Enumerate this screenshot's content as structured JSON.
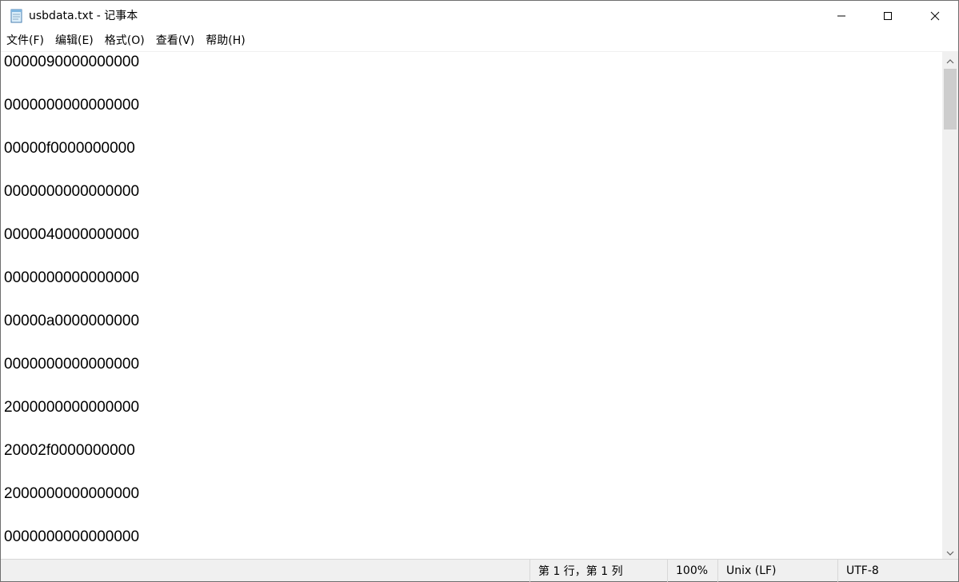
{
  "window": {
    "title": "usbdata.txt - 记事本"
  },
  "icons": {
    "app": "notepad-icon",
    "minimize": "minimize-icon",
    "maximize": "maximize-icon",
    "close": "close-icon",
    "scroll_up": "chevron-up-icon",
    "scroll_down": "chevron-down-icon"
  },
  "menu": {
    "file": "文件(F)",
    "edit": "编辑(E)",
    "format": "格式(O)",
    "view": "查看(V)",
    "help": "帮助(H)"
  },
  "editor": {
    "lines": [
      "0000090000000000",
      "0000000000000000",
      "00000f0000000000",
      "0000000000000000",
      "0000040000000000",
      "0000000000000000",
      "00000a0000000000",
      "0000000000000000",
      "2000000000000000",
      "20002f0000000000",
      "2000000000000000",
      "0000000000000000"
    ]
  },
  "status": {
    "position": "第 1 行，第 1 列",
    "zoom": "100%",
    "line_ending": "Unix (LF)",
    "encoding": "UTF-8"
  }
}
